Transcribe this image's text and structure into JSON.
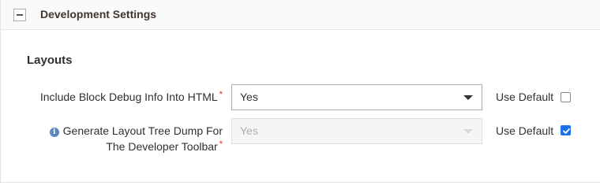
{
  "section": {
    "title": "Development Settings",
    "collapse_icon": "minus-icon",
    "expanded": true
  },
  "group": {
    "title": "Layouts"
  },
  "fields": [
    {
      "label": "Include Block Debug Info Into HTML",
      "required_mark": "*",
      "value": "Yes",
      "disabled": false,
      "use_default_label": "Use Default",
      "use_default_checked": false
    },
    {
      "info_icon": "info-icon",
      "info_glyph": "i",
      "label_line1": "Generate Layout Tree Dump For",
      "label_line2": "The Developer Toolbar",
      "required_mark": "*",
      "value": "Yes",
      "disabled": true,
      "use_default_label": "Use Default",
      "use_default_checked": true
    }
  ],
  "colors": {
    "required": "#e22626",
    "checkbox_checked": "#1a73e8",
    "info_icon": "#5b86c4"
  }
}
